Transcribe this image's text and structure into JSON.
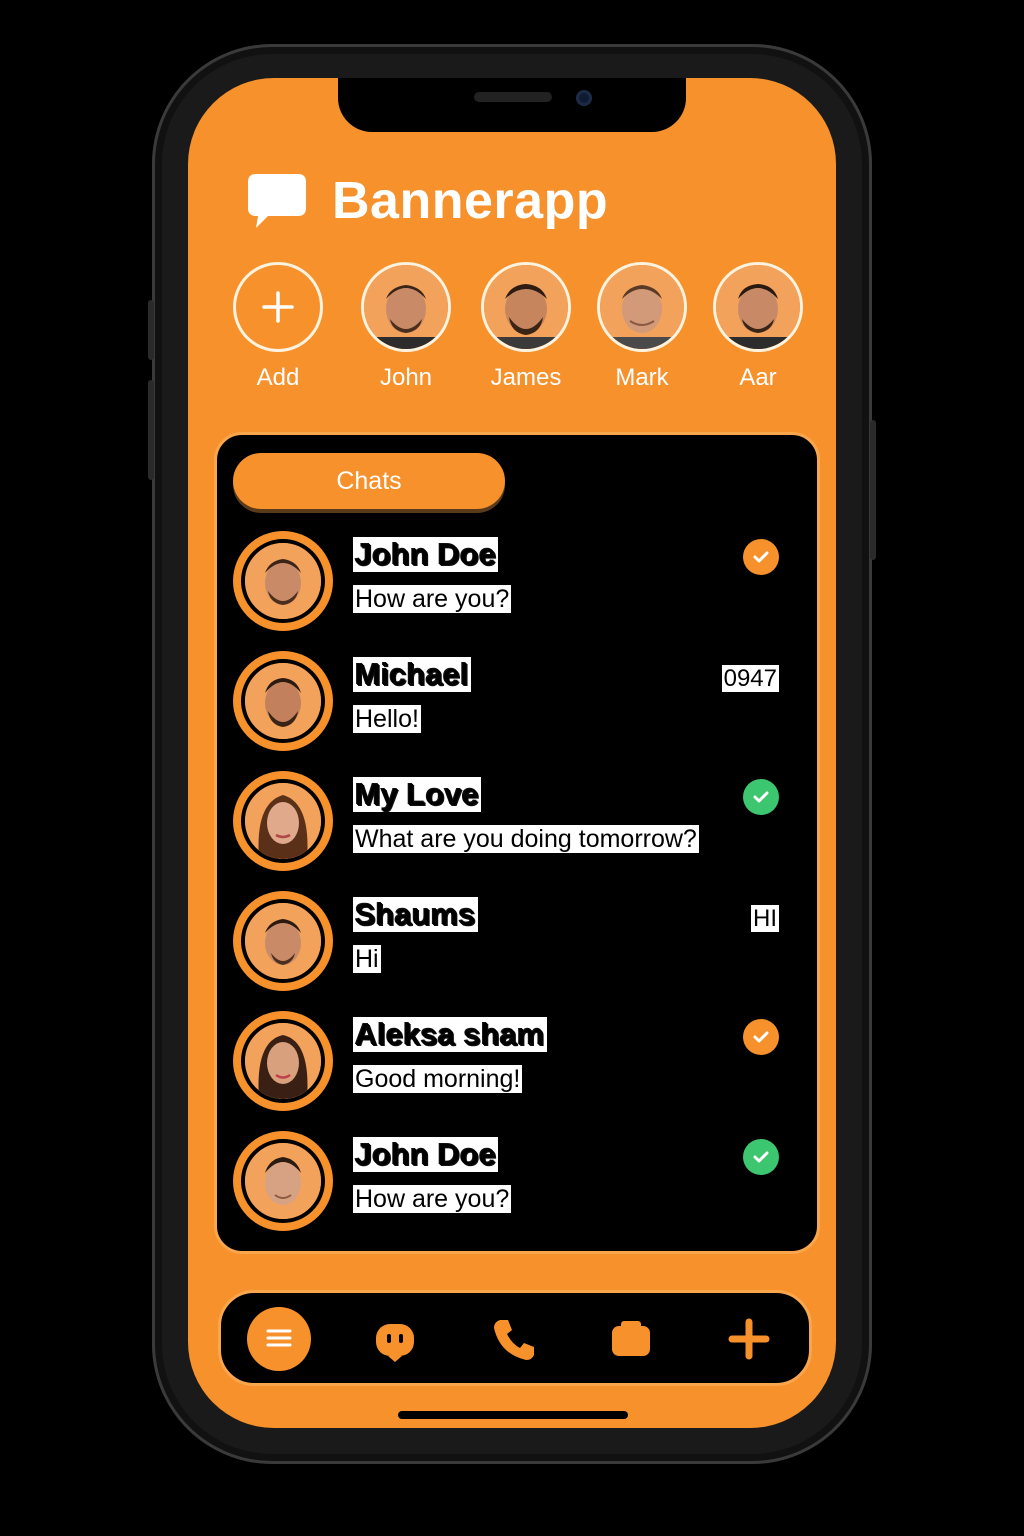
{
  "app": {
    "title": "Bannerapp",
    "accent_color": "#f7912c",
    "check_green": "#3cc66f"
  },
  "stories": [
    {
      "label": "Add",
      "icon": "plus-icon"
    },
    {
      "label": "John",
      "icon": "avatar"
    },
    {
      "label": "James",
      "icon": "avatar"
    },
    {
      "label": "Mark",
      "icon": "avatar"
    },
    {
      "label": "Aar",
      "icon": "avatar"
    }
  ],
  "tabs": {
    "chats_label": "Chats"
  },
  "chats": [
    {
      "name": "John Doe",
      "message": "How are you?",
      "status": "check-orange",
      "meta": ""
    },
    {
      "name": "Michael",
      "message": "Hello!",
      "status": "time",
      "meta": "0947"
    },
    {
      "name": "My Love",
      "message": "What are you doing tomorrow?",
      "status": "check-green",
      "meta": ""
    },
    {
      "name": "Shaums",
      "message": "Hi",
      "status": "text",
      "meta": "HI"
    },
    {
      "name": "Aleksa sham",
      "message": "Good morning!",
      "status": "check-orange",
      "meta": ""
    },
    {
      "name": "John Doe",
      "message": "How are you?",
      "status": "check-green",
      "meta": ""
    }
  ],
  "bottom_nav": [
    {
      "icon": "chat-list-icon",
      "active": true
    },
    {
      "icon": "bot-icon",
      "active": false
    },
    {
      "icon": "phone-icon",
      "active": false
    },
    {
      "icon": "camera-icon",
      "active": false
    },
    {
      "icon": "plus-icon",
      "active": false
    }
  ]
}
